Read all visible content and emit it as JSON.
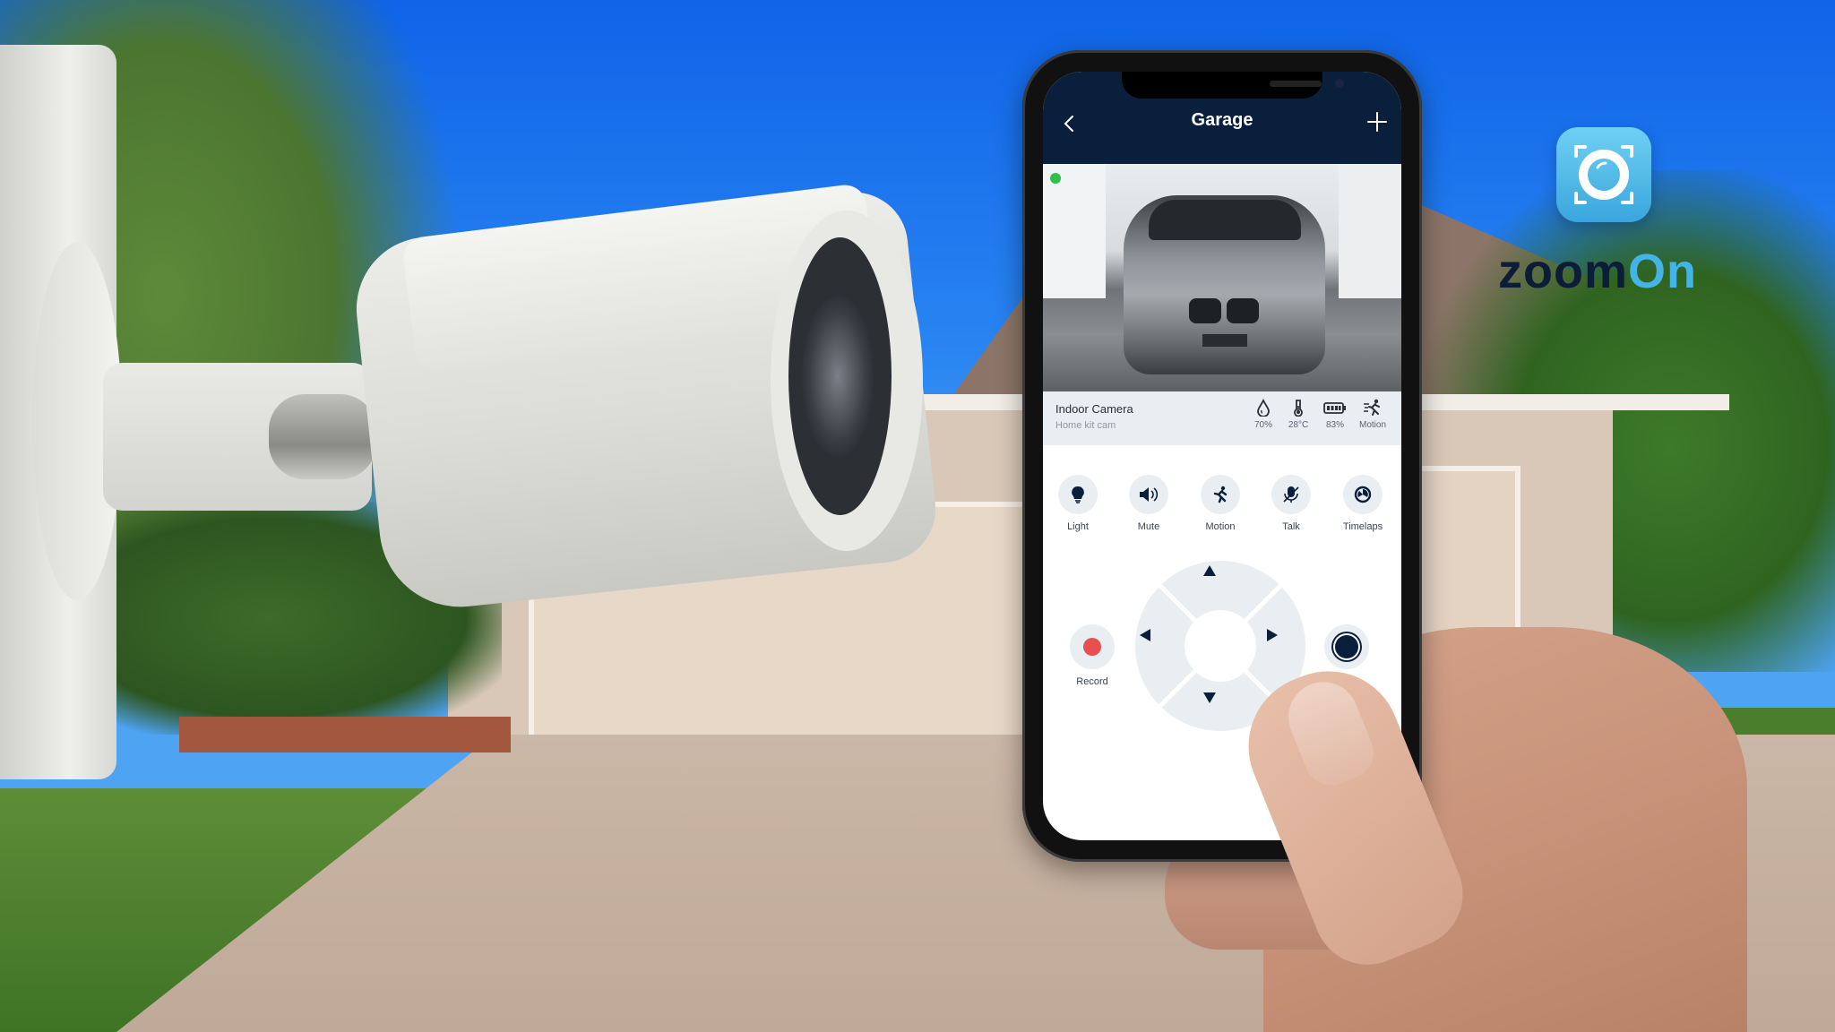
{
  "scene": {
    "description": "outdoor security camera in front of house with hand holding phone",
    "colors": {
      "sky": "#1d7cf0",
      "house_wall": "#d9c8b7",
      "driveway": "#c4af9e",
      "grass": "#4f8530"
    }
  },
  "brand": {
    "name_dark": "zoom",
    "name_light": "On",
    "icon": "camera-lens-app-icon",
    "colors": {
      "dark": "#0d1d38",
      "light": "#43b4e5"
    }
  },
  "app": {
    "header": {
      "title": "Garage",
      "back_icon": "chevron-left-icon",
      "add_icon": "plus-icon",
      "background": "#0a1f3c"
    },
    "feed": {
      "status": "live",
      "status_color": "#2fc04a",
      "content": "silver car parked in garage"
    },
    "camera_info": {
      "name": "Indoor Camera",
      "subtitle": "Home kit cam",
      "stats": [
        {
          "icon": "humidity-drop-icon",
          "label": "70%"
        },
        {
          "icon": "thermometer-icon",
          "label": "28°C"
        },
        {
          "icon": "battery-icon",
          "label": "83%"
        },
        {
          "icon": "motion-runner-icon",
          "label": "Motion"
        }
      ]
    },
    "actions": [
      {
        "icon": "lightbulb-icon",
        "label": "Light"
      },
      {
        "icon": "speaker-icon",
        "label": "Mute"
      },
      {
        "icon": "running-person-icon",
        "label": "Motion"
      },
      {
        "icon": "microphone-muted-icon",
        "label": "Talk"
      },
      {
        "icon": "timelapse-icon",
        "label": "Timelaps"
      }
    ],
    "controls": {
      "record_label": "Record",
      "record_color": "#e85050",
      "dpad": [
        "up",
        "down",
        "left",
        "right"
      ]
    }
  }
}
